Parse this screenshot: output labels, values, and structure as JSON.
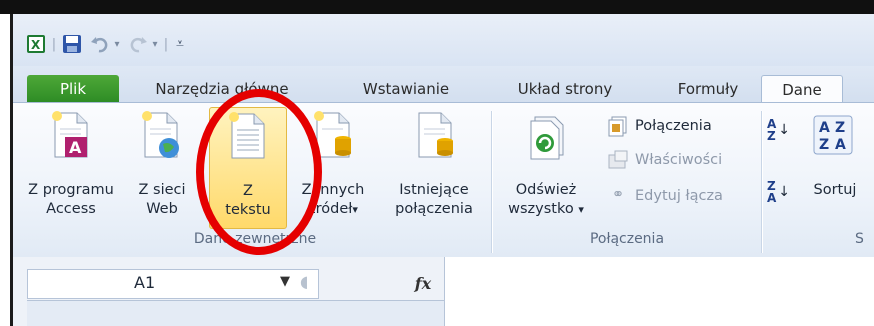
{
  "qat": {
    "excel_icon": "excel-icon",
    "save_icon": "save-icon",
    "undo_icon": "undo-icon",
    "redo_icon": "redo-icon",
    "customize_icon": "customize-qat-icon"
  },
  "tabs": [
    {
      "label": "Plik"
    },
    {
      "label": "Narzędzia główne"
    },
    {
      "label": "Wstawianie"
    },
    {
      "label": "Układ strony"
    },
    {
      "label": "Formuły"
    },
    {
      "label": "Dane"
    }
  ],
  "groups": {
    "external_data": {
      "label": "Dane zewnętrzne",
      "from_access": {
        "line1": "Z programu",
        "line2": "Access"
      },
      "from_web": {
        "line1": "Z sieci",
        "line2": "Web"
      },
      "from_text": {
        "line1": "Z",
        "line2": "tekstu"
      },
      "from_other": {
        "line1": "Z innych",
        "line2": "źródeł",
        "arrow": "▾"
      },
      "existing": {
        "line1": "Istniejące",
        "line2": "połączenia"
      }
    },
    "connections": {
      "label": "Połączenia",
      "refresh": {
        "line1": "Odśwież",
        "line2": "wszystko",
        "arrow": "▾"
      },
      "connections": "Połączenia",
      "properties": "Właściwości",
      "edit_links": "Edytuj łącza"
    },
    "sort": {
      "label": "S",
      "sort": "Sortuj"
    }
  },
  "formula_bar": {
    "name_box": "A1",
    "fx": "fx"
  },
  "colors": {
    "file_tab": "#3a9a2c",
    "highlight": "#ffd96a",
    "annotation": "#e50000"
  }
}
